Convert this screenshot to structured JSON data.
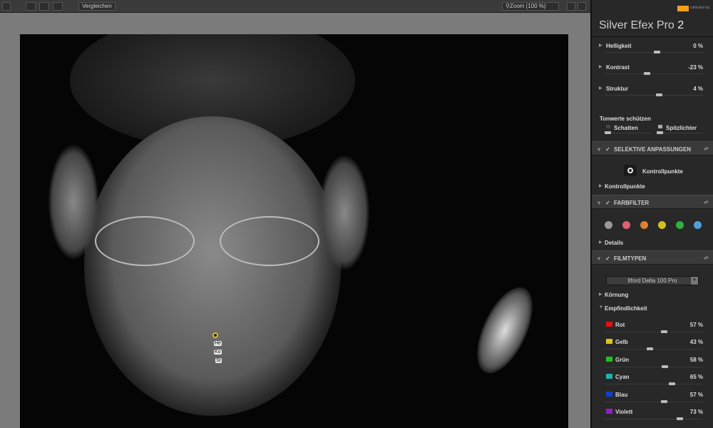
{
  "toolbar": {
    "compare_label": "Vergleichen",
    "zoom_label": "Zoom (100 %)"
  },
  "panel": {
    "logo_text": "collection by",
    "title": "Silver Efex Pro",
    "title_version": "2",
    "global": [
      {
        "label": "Helligkeit",
        "value": "0 %",
        "pos": 0.5
      },
      {
        "label": "Kontrast",
        "value": "-23 %",
        "pos": 0.38
      },
      {
        "label": "Struktur",
        "value": "4 %",
        "pos": 0.52
      }
    ],
    "protect": {
      "title": "Tonwerte schützen",
      "shadows": "Schatten",
      "highlights": "Spitzlichter"
    },
    "selective": {
      "header": "SELEKTIVE ANPASSUNGEN",
      "button": "Kontrollpunkte",
      "sub": "Kontrollpunkte"
    },
    "colorfilter": {
      "header": "FARBFILTER",
      "colors": [
        "#9a9a9a",
        "#e06070",
        "#e08030",
        "#d0c020",
        "#30b040",
        "#50a0d8"
      ],
      "details": "Details"
    },
    "film": {
      "header": "FILMTYPEN",
      "selected": "Ilford Delta 100 Pro",
      "grain": "Körnung",
      "sensitivity": "Empfindlichkeit",
      "channels": [
        {
          "label": "Rot",
          "value": "57 %",
          "color": "#e01010",
          "pos": 0.57
        },
        {
          "label": "Gelb",
          "value": "43 %",
          "color": "#e0c020",
          "pos": 0.43
        },
        {
          "label": "Grün",
          "value": "58 %",
          "color": "#20c020",
          "pos": 0.58
        },
        {
          "label": "Cyan",
          "value": "65 %",
          "color": "#20b0b0",
          "pos": 0.65
        },
        {
          "label": "Blau",
          "value": "57 %",
          "color": "#1040d0",
          "pos": 0.57
        },
        {
          "label": "Violett",
          "value": "73 %",
          "color": "#9020c0",
          "pos": 0.73
        }
      ]
    }
  },
  "control_point": {
    "labels": [
      "He",
      "Ko",
      "St"
    ]
  }
}
